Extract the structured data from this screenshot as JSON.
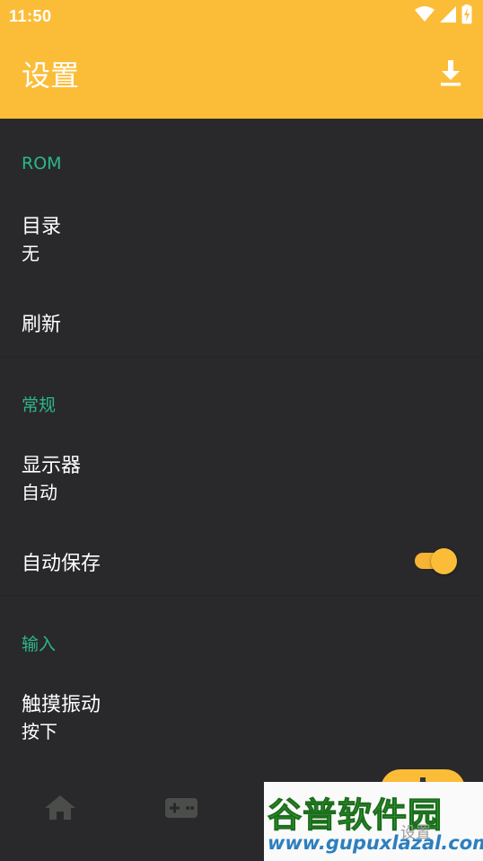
{
  "status_bar": {
    "time": "11:50",
    "icons": [
      "wifi-icon",
      "signal-icon",
      "battery-charging-icon"
    ]
  },
  "app_bar": {
    "title": "设置",
    "action_icon": "download-icon",
    "color": "#fbbd38"
  },
  "sections": {
    "rom": {
      "header": "ROM",
      "directory": {
        "title": "目录",
        "summary": "无"
      },
      "refresh": {
        "title": "刷新"
      }
    },
    "general": {
      "header": "常规",
      "display": {
        "title": "显示器",
        "summary": "自动"
      },
      "autosave": {
        "title": "自动保存",
        "enabled": true
      }
    },
    "input": {
      "header": "输入",
      "haptic": {
        "title": "触摸振动",
        "summary": "按下"
      }
    }
  },
  "bottom_nav": {
    "items": [
      {
        "icon": "home-icon"
      },
      {
        "icon": "gamepad-icon"
      },
      {
        "icon": "gear-icon",
        "label": "设置",
        "selected": true
      }
    ]
  },
  "watermark": {
    "brand": "谷普软件园",
    "url": "www.gupuxlazal.com"
  },
  "colors": {
    "accent": "#fbbd38",
    "section_header": "#2bb78a",
    "background": "#29292b"
  }
}
